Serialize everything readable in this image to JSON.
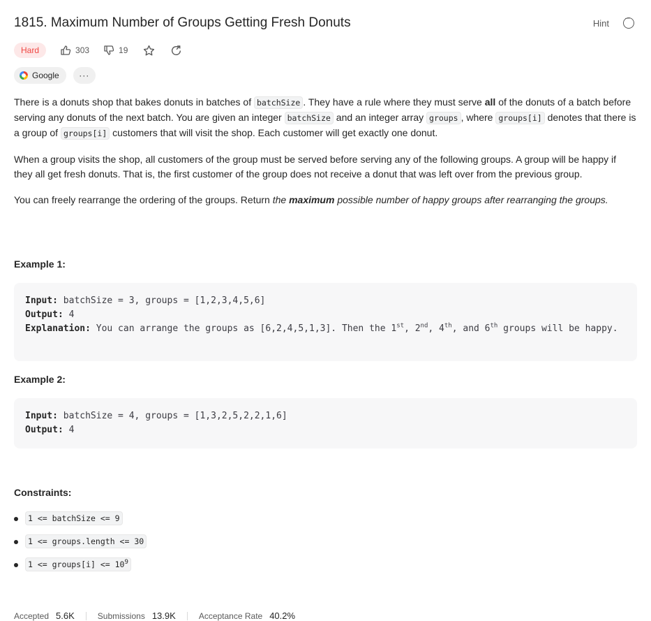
{
  "problem": {
    "title": "1815. Maximum Number of Groups Getting Fresh Donuts",
    "hint_label": "Hint",
    "difficulty": "Hard",
    "likes": "303",
    "dislikes": "19",
    "company_tag": "Google",
    "more_tags_label": "···"
  },
  "description": {
    "p1_a": "There is a donuts shop that bakes donuts in batches of ",
    "p1_code1": "batchSize",
    "p1_b": ". They have a rule where they must serve ",
    "p1_bold": "all",
    "p1_c": " of the donuts of a batch before serving any donuts of the next batch. You are given an integer ",
    "p1_code2": "batchSize",
    "p1_d": " and an integer array ",
    "p1_code3": "groups",
    "p1_e": ", where ",
    "p1_code4": "groups[i]",
    "p1_f": " denotes that there is a group of ",
    "p1_code5": "groups[i]",
    "p1_g": " customers that will visit the shop. Each customer will get exactly one donut.",
    "p2": "When a group visits the shop, all customers of the group must be served before serving any of the following groups. A group will be happy if they all get fresh donuts. That is, the first customer of the group does not receive a donut that was left over from the previous group.",
    "p3_a": "You can freely rearrange the ordering of the groups. Return ",
    "p3_em1": "the ",
    "p3_bold": "maximum",
    "p3_em2": " possible number of happy groups after rearranging the groups."
  },
  "examples": [
    {
      "title": "Example 1:",
      "input_label": "Input:",
      "input": " batchSize = 3, groups = [1,2,3,4,5,6]",
      "output_label": "Output:",
      "output": " 4",
      "explanation_label": "Explanation:",
      "expl_a": " You can arrange the groups as [6,2,4,5,1,3]. Then the 1",
      "expl_sup1": "st",
      "expl_b": ", 2",
      "expl_sup2": "nd",
      "expl_c": ", 4",
      "expl_sup3": "th",
      "expl_d": ", and 6",
      "expl_sup4": "th",
      "expl_e": " groups will be happy."
    },
    {
      "title": "Example 2:",
      "input_label": "Input:",
      "input": " batchSize = 4, groups = [1,3,2,5,2,2,1,6]",
      "output_label": "Output:",
      "output": " 4"
    }
  ],
  "constraints": {
    "title": "Constraints:",
    "items": [
      "1 <= batchSize <= 9",
      "1 <= groups.length <= 30",
      "1 <= groups[i] <= 10"
    ],
    "item3_sup": "9"
  },
  "footer": {
    "accepted_label": "Accepted",
    "accepted_value": "5.6K",
    "submissions_label": "Submissions",
    "submissions_value": "13.9K",
    "rate_label": "Acceptance Rate",
    "rate_value": "40.2%"
  }
}
